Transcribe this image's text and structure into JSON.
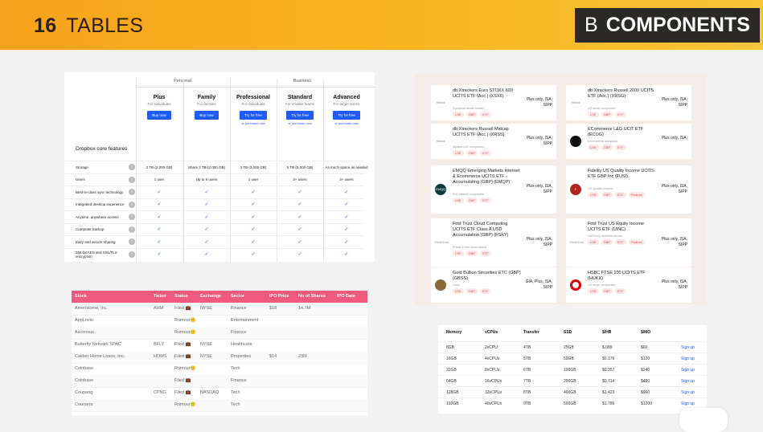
{
  "header": {
    "number": "16",
    "title": "TABLES",
    "badge_letter": "B",
    "badge_label": "COMPONENTS"
  },
  "dropbox": {
    "groups": [
      "Personal",
      "Business"
    ],
    "plans": [
      {
        "name": "Plus",
        "desc": "For individuals",
        "button": "Buy now",
        "link": ""
      },
      {
        "name": "Family",
        "desc": "For families",
        "button": "Buy now",
        "link": ""
      },
      {
        "name": "Professional",
        "desc": "For individuals",
        "button": "Try for free",
        "link": "or purchase now"
      },
      {
        "name": "Standard",
        "desc": "For smaller teams",
        "button": "Try for free",
        "link": "or purchase now"
      },
      {
        "name": "Advanced",
        "desc": "For larger teams",
        "button": "Try for free",
        "link": "or purchase now"
      }
    ],
    "section_title": "Dropbox core features",
    "features": [
      {
        "label": "Storage",
        "values": [
          "2 TB (2,000 GB)",
          "Share 2 TB (2,000 GB)",
          "3 TB (3,000 GB)",
          "5 TB (5,000 GB)",
          "As much space as needed"
        ]
      },
      {
        "label": "Users",
        "values": [
          "1 user",
          "Up to 6 users",
          "1 user",
          "3+ users",
          "3+ users"
        ]
      },
      {
        "label": "Best-in-class sync technology",
        "values": [
          "✓",
          "✓",
          "✓",
          "✓",
          "✓"
        ]
      },
      {
        "label": "Integrated desktop experience",
        "values": [
          "✓",
          "✓",
          "✓",
          "✓",
          "✓"
        ]
      },
      {
        "label": "Anytime, anywhere access",
        "values": [
          "✓",
          "✓",
          "✓",
          "✓",
          "✓"
        ]
      },
      {
        "label": "Computer backup",
        "values": [
          "✓",
          "✓",
          "✓",
          "✓",
          "✓"
        ]
      },
      {
        "label": "Easy and secure sharing",
        "values": [
          "✓",
          "✓",
          "✓",
          "✓",
          "✓"
        ]
      },
      {
        "label": "256-bit AES and SSL/TLS encryption",
        "values": [
          "✓",
          "✓",
          "✓",
          "✓",
          "✓"
        ]
      }
    ]
  },
  "ipo": {
    "columns": [
      "Stock",
      "Ticker",
      "Status",
      "Exchange",
      "Sector",
      "IPO Price",
      "No of Shares",
      "IPO Date"
    ],
    "rows": [
      [
        "AmeriHome, Inc.",
        "AHM",
        "Filed 💼",
        "NYSE",
        "Finance",
        "$18",
        "14.7M",
        ""
      ],
      [
        "AppLovin",
        "",
        "Rumour🤫",
        "",
        "Entertainment",
        "",
        "",
        ""
      ],
      [
        "Ascensus",
        "",
        "Rumour🤫",
        "",
        "Finance",
        "",
        "",
        ""
      ],
      [
        "Butterfly Network SPAC",
        "BFLY",
        "Filed 💼",
        "NYSE",
        "Healthcare",
        "",
        "",
        ""
      ],
      [
        "Caliber Home Loans, Inc.",
        "HOMS",
        "Filed 💼",
        "NYSE",
        "Properties",
        "$14",
        "23M",
        ""
      ],
      [
        "Coinbase",
        "",
        "Rumour🤫",
        "",
        "Tech",
        "",
        "",
        ""
      ],
      [
        "Coinbase",
        "",
        "Filed 💼",
        "",
        "Finance",
        "",
        "",
        ""
      ],
      [
        "Coupang",
        "CPNG",
        "Filed 💼",
        "NASDAQ",
        "Tech",
        "",
        "",
        ""
      ],
      [
        "Coursera",
        "",
        "Rumour🤫",
        "",
        "Tech",
        "",
        "",
        ""
      ]
    ]
  },
  "etfs": [
    {
      "name": "db Xtrackers Euro STOXX 600 UCITS ETF (Acc.) (XSX6)",
      "desc": "European stock market",
      "tags": [
        "LSE",
        "GBP",
        "ETF"
      ],
      "avail": "Plus only, ISA, SIPP",
      "logo": "Xtrack"
    },
    {
      "name": "db Xtrackers Russell 2000 UCITS ETF (Acc.) (XRSG)",
      "desc": "US small companies",
      "tags": [
        "LSE",
        "GBP",
        "ETF"
      ],
      "avail": "Plus only, ISA, SIPP",
      "logo": "Xtrack"
    },
    {
      "name": "db Xtrackers Russell Midcap UCITS ETF (Acc.) (XRSS)",
      "desc": "Medium US companies",
      "tags": [
        "LSE",
        "GBP",
        "ETF"
      ],
      "avail": "Plus only, ISA, SIPP",
      "logo": "Xtrack"
    },
    {
      "name": "ECommerce L&G UCIT ETF (ECOG)",
      "desc": "Ecommerce company",
      "tags": [
        "LSE",
        "GBP",
        "ETF"
      ],
      "avail": "Plus only, ISA,",
      "logo": ""
    },
    {
      "name": "EMQQ Emerging Markets Internet & Ecommerce UCITS ETF - Accumulating (GBP) (EMQP)",
      "desc": "EM internet companies",
      "tags": [
        "LSE",
        "GBP",
        "ETF"
      ],
      "avail": "Plus only, ISA, SIPP",
      "logo": "EMQQ"
    },
    {
      "name": "Fidelity US Quality Income UCITS ETF GBP Inc (FUSI)",
      "desc": "US Quality Income",
      "tags": [
        "LSE",
        "GBP",
        "ETF",
        "Finance"
      ],
      "avail": "Plus only, ISA, SIPP",
      "logo": "F"
    },
    {
      "name": "First Trust Cloud Computing UCITS ETF Class A USD Accumulation (GBP) (FSKY)",
      "desc": "Prices in the cloud space",
      "tags": [
        "LSE",
        "GBP",
        "ETF"
      ],
      "avail": "Plus only, ISA, SIPP",
      "logo": "FirstTrust"
    },
    {
      "name": "First Trust US Equity Income UCITS ETF (UINC)",
      "desc": "NASDAQ dividend stocks",
      "tags": [
        "LSE",
        "GBP",
        "ETF",
        "Finance"
      ],
      "avail": "Plus only, ISA, SIPP",
      "logo": "FirstTrust"
    },
    {
      "name": "Gold Bullion Securities ETC (GBP) (GBSS)",
      "desc": "Gold",
      "tags": [
        "LSE",
        "GBP",
        "ETF"
      ],
      "avail": "GIA, Plus, ISA, SIPP",
      "logo": ""
    },
    {
      "name": "HSBC FTSE 100 UCITS ETF (HUKX)",
      "desc": "UK large companies",
      "tags": [
        "LSE",
        "GBP",
        "ETF"
      ],
      "avail": "Plus only, ISA, SIPP",
      "logo": ""
    }
  ],
  "hosting": {
    "columns": [
      "Memory",
      "vCPUs",
      "Transfer",
      "SSD",
      "$/HR",
      "$/MO",
      ""
    ],
    "rows": [
      [
        "8GB",
        "2vCPU",
        "4TB",
        "25GB",
        "$.089",
        "$60",
        "Sign up"
      ],
      [
        "16GB",
        "4vCPUs",
        "5TB",
        "50GB",
        "$0.179",
        "$120",
        "Sign up"
      ],
      [
        "32GB",
        "8vCPUs",
        "6TB",
        "100GB",
        "$0.357",
        "$240",
        "Sign up"
      ],
      [
        "64GB",
        "16vCPUs",
        "7TB",
        "200GB",
        "$0.714",
        "$480",
        "Sign up"
      ],
      [
        "128GB",
        "32vCPUs",
        "8TB",
        "400GB",
        "$1.423",
        "$960",
        "Sign up"
      ],
      [
        "192GB",
        "40vCPUs",
        "9TB",
        "500GB",
        "$1.786",
        "$1200",
        "Sign up"
      ]
    ]
  },
  "colors": {
    "accent": "#f8b51f",
    "pink": "#f05a7e",
    "blue": "#1f5bff",
    "dark": "#2b2926"
  }
}
